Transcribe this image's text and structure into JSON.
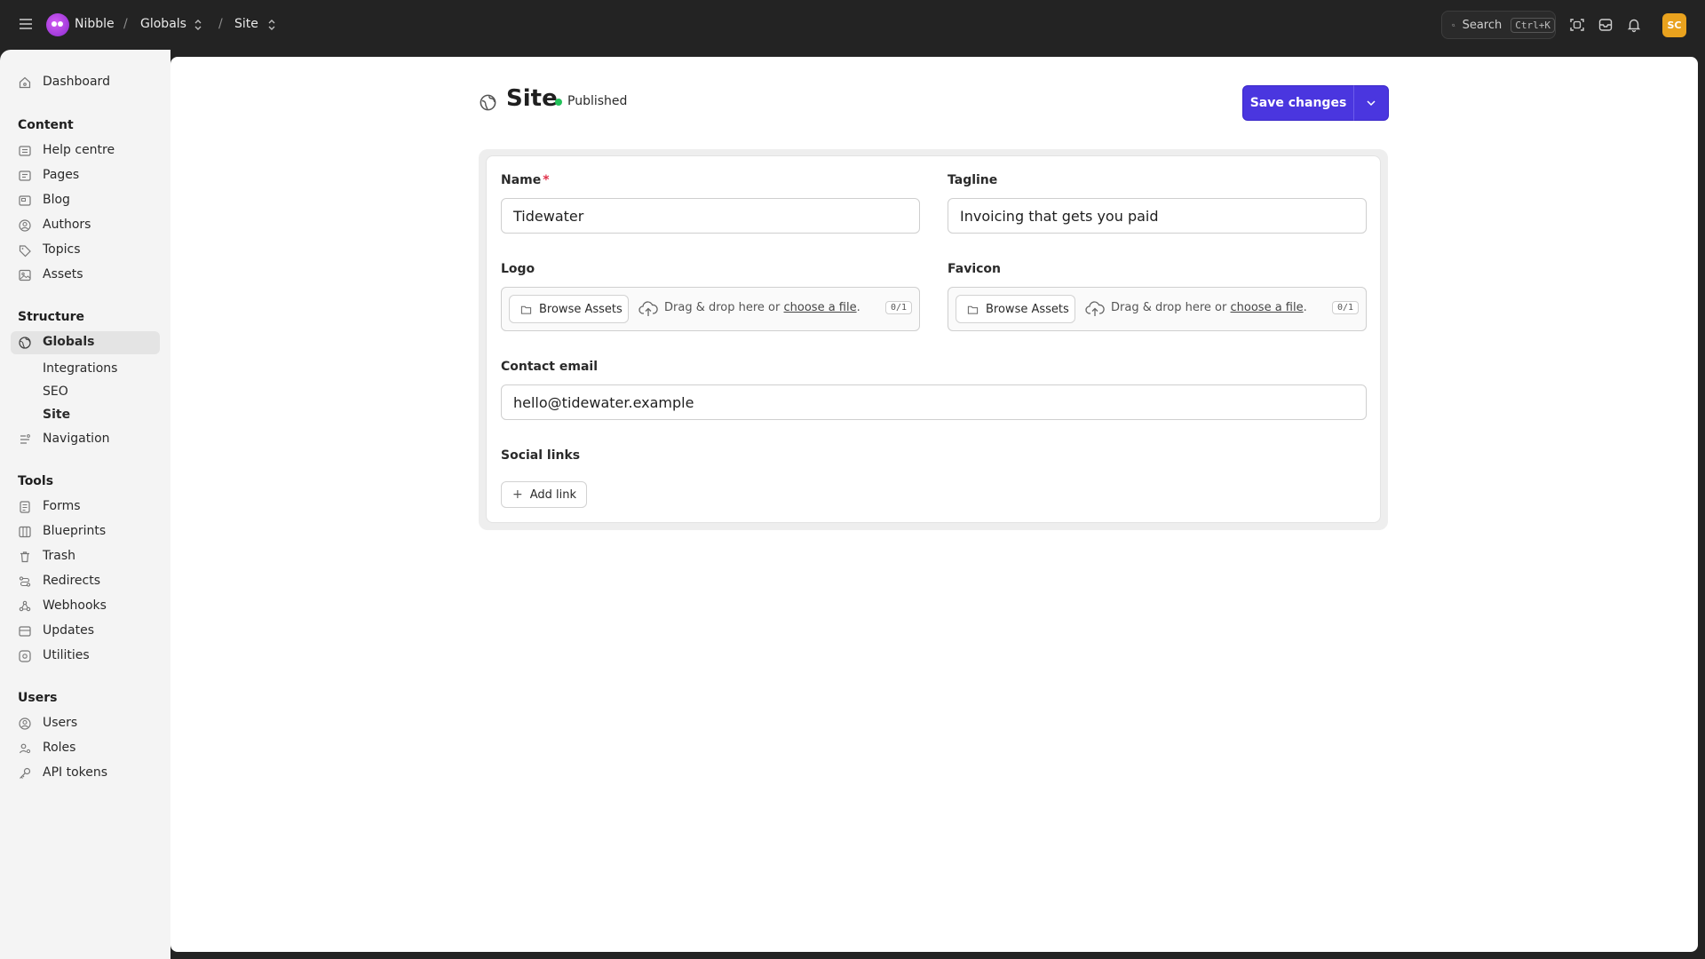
{
  "topbar": {
    "brand": "Nibble",
    "crumb_sep": "/",
    "crumbs": [
      "Globals",
      "Site"
    ],
    "search_label": "Search",
    "search_shortcut": "Ctrl+K",
    "avatar_initials": "SC"
  },
  "sidebar": {
    "dashboard": "Dashboard",
    "sections": [
      {
        "title": "Content",
        "items": [
          "Help centre",
          "Pages",
          "Blog",
          "Authors",
          "Topics",
          "Assets"
        ]
      },
      {
        "title": "Structure",
        "items": [
          "Globals",
          "Navigation"
        ],
        "sub_items": [
          "Integrations",
          "SEO",
          "Site"
        ]
      },
      {
        "title": "Tools",
        "items": [
          "Forms",
          "Blueprints",
          "Trash",
          "Redirects",
          "Webhooks",
          "Updates",
          "Utilities"
        ]
      },
      {
        "title": "Users",
        "items": [
          "Users",
          "Roles",
          "API tokens"
        ]
      }
    ]
  },
  "page": {
    "title": "Site",
    "status": "Published",
    "save_label": "Save changes"
  },
  "form": {
    "name_label": "Name",
    "name_required": "*",
    "name_value": "Tidewater",
    "tagline_label": "Tagline",
    "tagline_value": "Invoicing that gets you paid",
    "logo_label": "Logo",
    "favicon_label": "Favicon",
    "browse_label": "Browse Assets",
    "drop_text": "Drag & drop here or",
    "choose_link": "choose a file",
    "drop_suffix": ".",
    "count": "0/1",
    "email_label": "Contact email",
    "email_value": "hello@tidewater.example",
    "social_label": "Social links",
    "add_link_label": "Add link"
  },
  "colors": {
    "accent": "#4a36df",
    "published": "#23c15a",
    "avatar": "#e9a21e"
  }
}
